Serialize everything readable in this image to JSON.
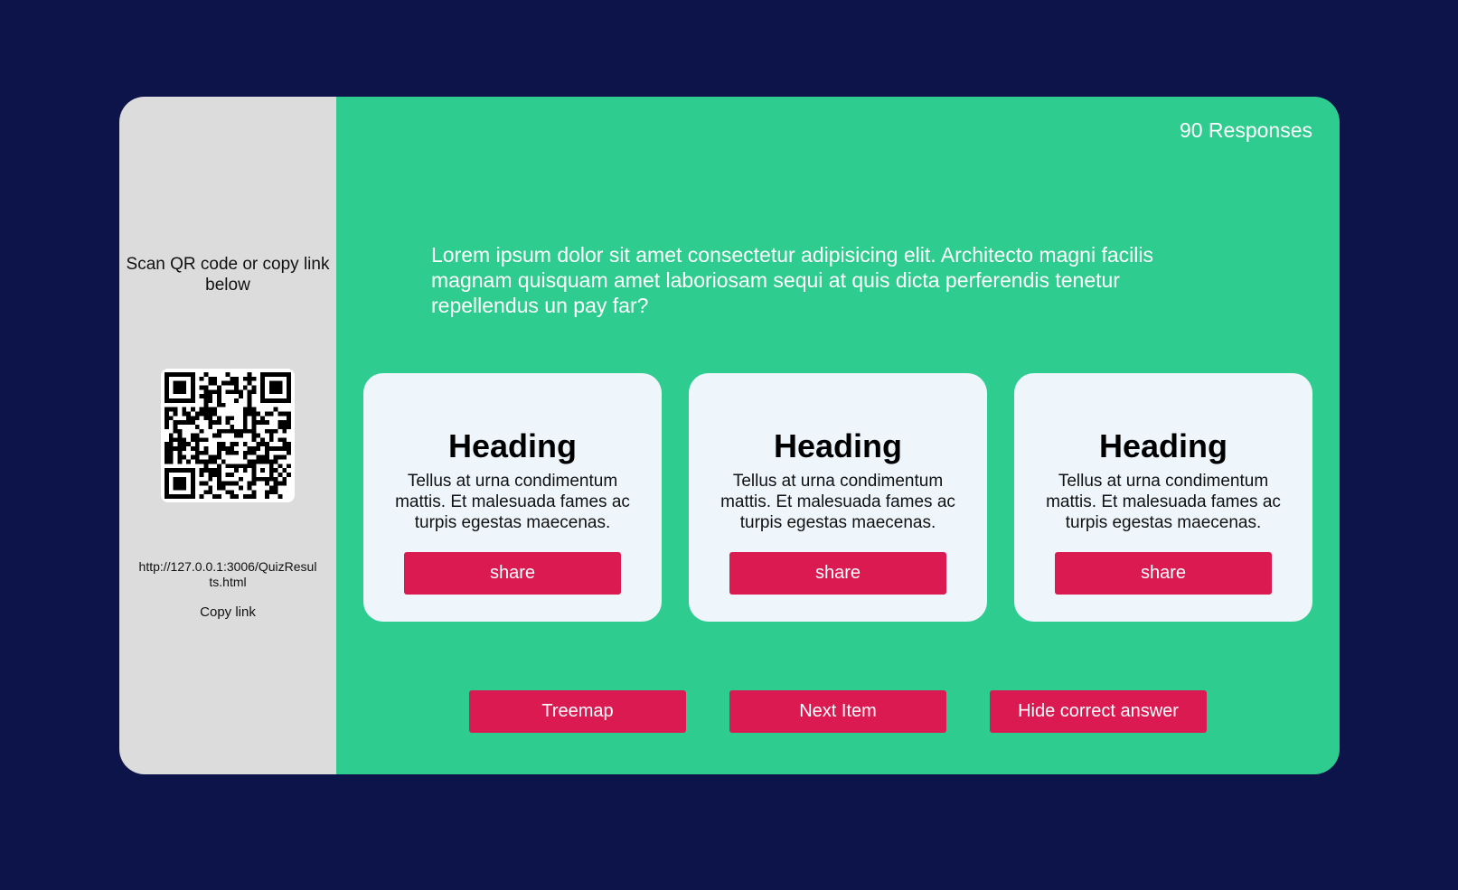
{
  "sidebar": {
    "scan_text": "Scan QR code or copy link below",
    "link": "http://127.0.0.1:3006/QuizResults.html",
    "copy_link_label": "Copy link"
  },
  "main": {
    "responses": "90 Responses",
    "question": "Lorem ipsum dolor sit amet consectetur adipisicing elit. Architecto magni facilis magnam quisquam amet laboriosam sequi at quis dicta perferendis tenetur repellendus un pay far?",
    "cards": [
      {
        "heading": "Heading",
        "body": "Tellus at urna condimentum mattis. Et malesuada fames ac turpis egestas maecenas.",
        "button": "share"
      },
      {
        "heading": "Heading",
        "body": "Tellus at urna condimentum mattis. Et malesuada fames ac turpis egestas maecenas.",
        "button": "share"
      },
      {
        "heading": "Heading",
        "body": "Tellus at urna condimentum mattis. Et malesuada fames ac turpis egestas maecenas.",
        "button": "share"
      }
    ],
    "buttons": {
      "treemap": "Treemap",
      "next_item": "Next Item",
      "hide_answer": "Hide correct answer"
    }
  },
  "colors": {
    "background": "#0c1449",
    "sidebar": "#dcdcdc",
    "main": "#2ecc8e",
    "card": "#eef6fc",
    "accent_button": "#db1a52"
  },
  "icons": {
    "qr": "qr-code-icon"
  }
}
